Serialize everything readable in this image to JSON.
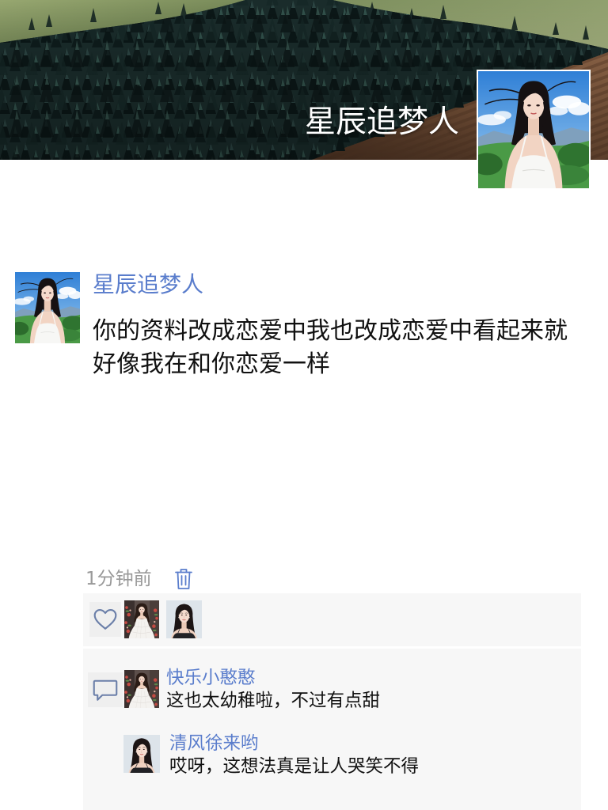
{
  "header": {
    "username": "星辰追梦人",
    "avatar": "woman-sky-avatar"
  },
  "post": {
    "author": "星辰追梦人",
    "avatar": "woman-sky-avatar",
    "text": "你的资料改成恋爱中我也改成恋爱中看起来就好像我在和你恋爱一样",
    "time": "1分钟前"
  },
  "likes": {
    "avatars": [
      "woman-white-gown-avatar",
      "woman-portrait-avatar"
    ]
  },
  "comments": [
    {
      "author": "快乐小憨憨",
      "avatar": "woman-white-gown-avatar",
      "text": "这也太幼稚啦，不过有点甜"
    },
    {
      "author": "清风徐来哟",
      "avatar": "woman-portrait-avatar",
      "text": "哎呀，这想法真是让人哭笑不得"
    }
  ],
  "icons": {
    "delete": "trash-icon",
    "like": "heart-icon",
    "comment": "comment-icon"
  },
  "colors": {
    "name_link": "#5a7dcc",
    "body_text": "#111111",
    "timestamp": "#999999",
    "panel_background": "#f7f7f7",
    "icon": "#6b7fa9",
    "delete_icon": "#5a7dcc"
  }
}
